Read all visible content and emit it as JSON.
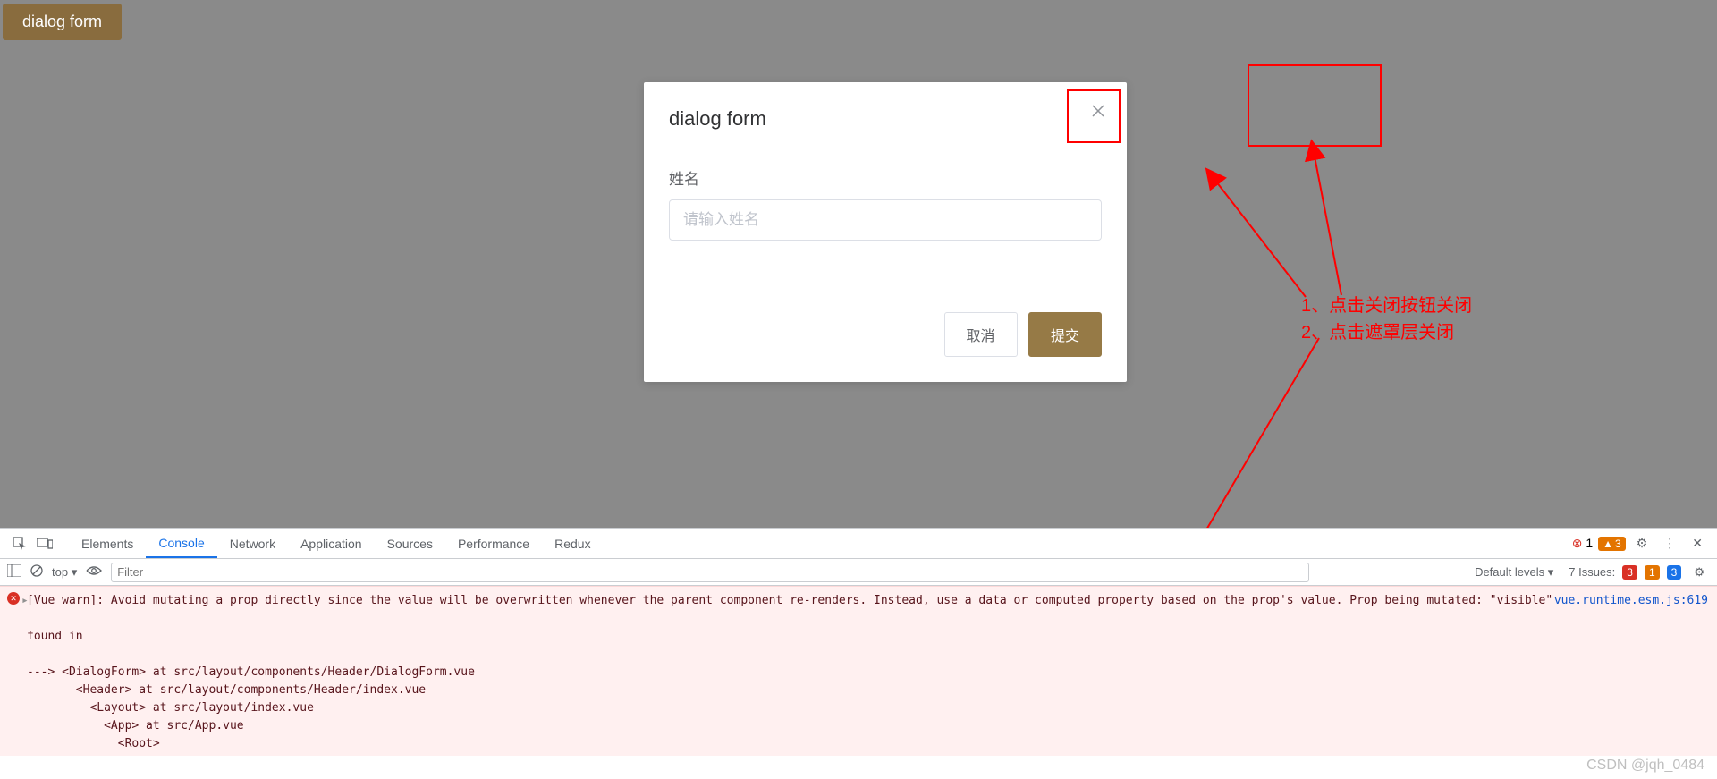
{
  "top_button": {
    "label": "dialog form"
  },
  "dialog": {
    "title": "dialog form",
    "field_label": "姓名",
    "placeholder": "请输入姓名",
    "cancel": "取消",
    "submit": "提交"
  },
  "annotations": {
    "line1": "1、点击关闭按钮关闭",
    "line2": "2、点击遮罩层关闭"
  },
  "devtools": {
    "tabs": [
      "Elements",
      "Console",
      "Network",
      "Application",
      "Sources",
      "Performance",
      "Redux"
    ],
    "active_tab": "Console",
    "err_count": "1",
    "warn_count": "3",
    "filter_row": {
      "top": "top",
      "filter_placeholder": "Filter",
      "levels": "Default levels",
      "issues_label": "7 Issues:",
      "issues_err": "3",
      "issues_warn": "1",
      "issues_info": "3"
    },
    "error": {
      "msg": "[Vue warn]: Avoid mutating a prop directly since the value will be overwritten whenever the parent component re-renders. Instead, use a data or computed property based on the prop's value. Prop being mutated: \"visible\"",
      "found_in": "found in",
      "stack": "---> <DialogForm> at src/layout/components/Header/DialogForm.vue\n       <Header> at src/layout/components/Header/index.vue\n         <Layout> at src/layout/index.vue\n           <App> at src/App.vue\n             <Root>",
      "link": "vue.runtime.esm.js:619"
    }
  },
  "watermark": "CSDN @jqh_0484"
}
